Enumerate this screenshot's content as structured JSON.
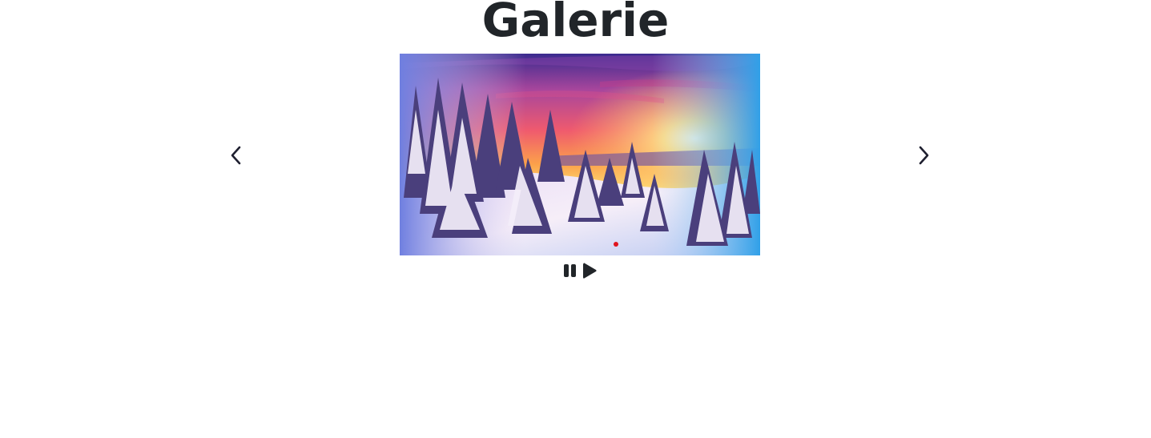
{
  "gallery": {
    "title": "Galerie"
  },
  "carousel": {
    "slide_count": 1,
    "active_index": 0,
    "indicator_color": "#e0141e",
    "prev_icon": "chevron-left-icon",
    "next_icon": "chevron-right-icon"
  },
  "controls": {
    "pause_icon": "pause-icon",
    "play_icon": "play-icon",
    "icon_color": "#212529"
  }
}
